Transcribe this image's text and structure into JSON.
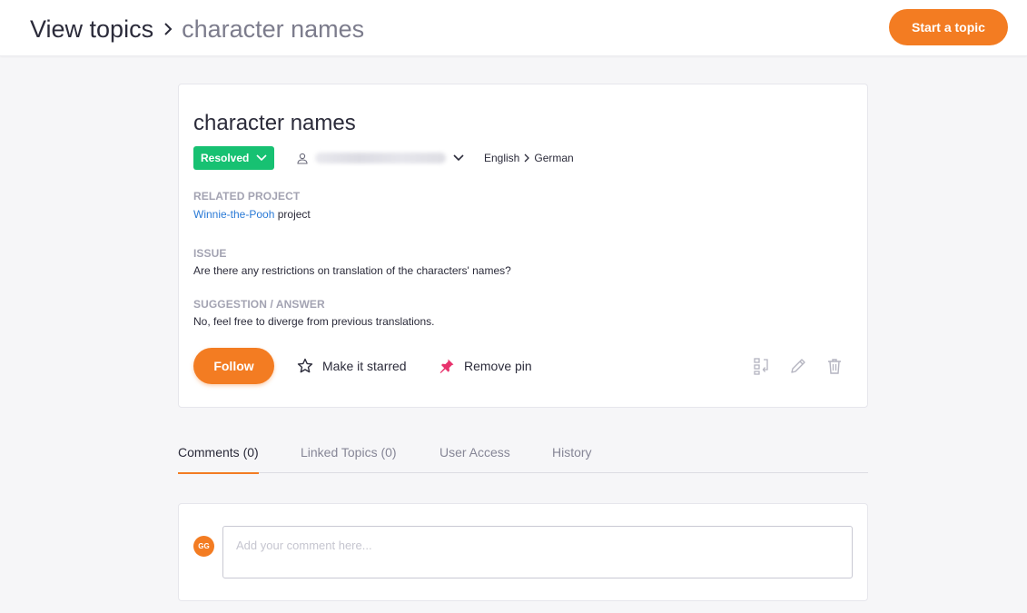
{
  "header": {
    "breadcrumb_root": "View topics",
    "breadcrumb_current": "character names",
    "start_topic_label": "Start a topic",
    "accent_color": "#f37c22"
  },
  "topic": {
    "title": "character names",
    "status": "Resolved",
    "status_color": "#17c172",
    "source_language": "English",
    "target_language": "German",
    "related_project_label": "RELATED PROJECT",
    "related_project_link": "Winnie-the-Pooh",
    "related_project_suffix": " project",
    "issue_label": "ISSUE",
    "issue_text": "Are there any restrictions on translation of the characters' names?",
    "suggestion_label": "SUGGESTION / ANSWER",
    "suggestion_text": "No, feel free to diverge from previous translations.",
    "follow_label": "Follow",
    "star_label": "Make it starred",
    "pin_label": "Remove pin"
  },
  "tabs": [
    {
      "label": "Comments (0)",
      "active": true
    },
    {
      "label": "Linked Topics (0)",
      "active": false
    },
    {
      "label": "User Access",
      "active": false
    },
    {
      "label": "History",
      "active": false
    }
  ],
  "comment": {
    "avatar_initials": "GG",
    "placeholder": "Add your comment here..."
  },
  "icons": {
    "user": "user-icon",
    "star": "star-outline-icon",
    "pin": "pin-icon",
    "link": "link-topics-icon",
    "edit": "pencil-icon",
    "delete": "trash-icon"
  }
}
